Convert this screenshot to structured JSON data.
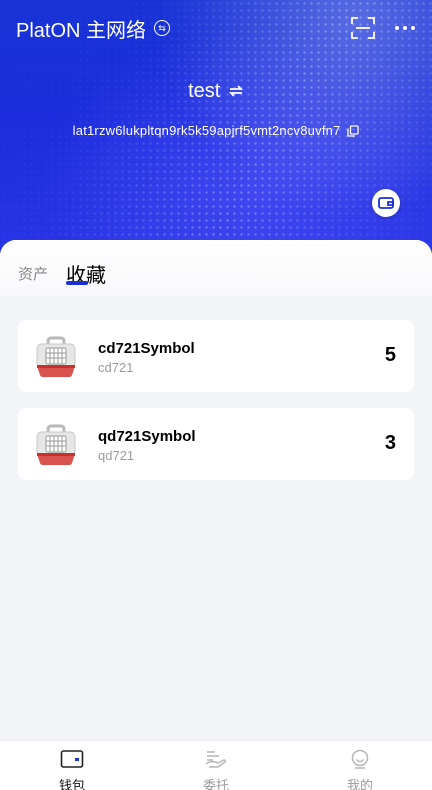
{
  "header": {
    "network_label": "PlatON 主网络",
    "wallet_name": "test",
    "address": "lat1rzw6lukpltqn9rk5k59apjrf5vmt2ncv8uvfn7"
  },
  "tabs": [
    {
      "label": "资产",
      "active": false
    },
    {
      "label": "收藏",
      "active": true
    }
  ],
  "nfts": [
    {
      "symbol": "cd721Symbol",
      "name": "cd721",
      "count": "5"
    },
    {
      "symbol": "qd721Symbol",
      "name": "qd721",
      "count": "3"
    }
  ],
  "bottom_nav": [
    {
      "label": "钱包",
      "icon": "wallet-icon",
      "active": true
    },
    {
      "label": "委托",
      "icon": "delegate-icon",
      "active": false
    },
    {
      "label": "我的",
      "icon": "profile-icon",
      "active": false
    }
  ],
  "colors": {
    "brand": "#1a2fd6",
    "inactive": "#9a9aa0"
  }
}
